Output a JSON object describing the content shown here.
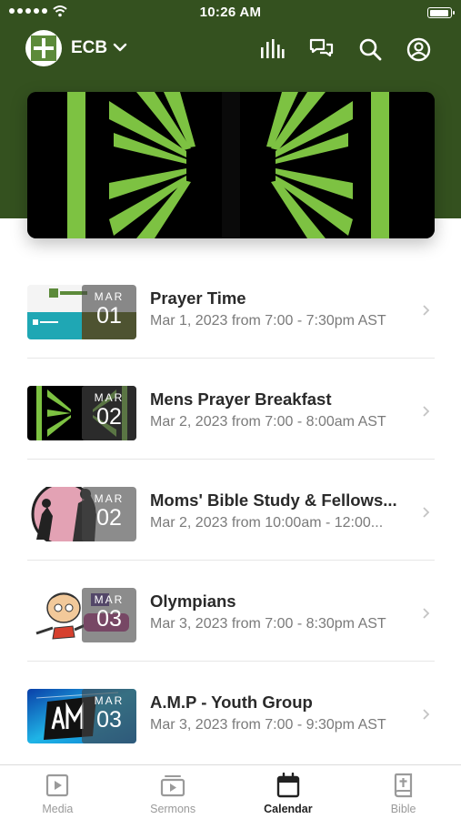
{
  "status_bar": {
    "time": "10:26 AM"
  },
  "header": {
    "church_name": "ECB"
  },
  "events": [
    {
      "title": "Prayer Time",
      "subtitle": "Mar 1, 2023 from 7:00 - 7:30pm AST",
      "month": "MAR",
      "day": "01",
      "thumb": "church-banner"
    },
    {
      "title": "Mens Prayer Breakfast",
      "subtitle": "Mar 2, 2023 from 7:00 - 8:00am AST",
      "month": "MAR",
      "day": "02",
      "thumb": "green-rays"
    },
    {
      "title": "Moms' Bible Study & Fellows...",
      "subtitle": "Mar 2, 2023 from 10:00am - 12:00...",
      "month": "MAR",
      "day": "02",
      "thumb": "mom-silhouette"
    },
    {
      "title": "Olympians",
      "subtitle": "Mar 3, 2023 from 7:00 - 8:30pm AST",
      "month": "MAR",
      "day": "03",
      "thumb": "cartoon-kid"
    },
    {
      "title": "A.M.P - Youth Group",
      "subtitle": "Mar 3, 2023 from 7:00 - 9:30pm AST",
      "month": "MAR",
      "day": "03",
      "thumb": "amp-logo"
    }
  ],
  "tabs": [
    {
      "label": "Media",
      "icon": "play-square-icon",
      "active": false
    },
    {
      "label": "Sermons",
      "icon": "video-library-icon",
      "active": false
    },
    {
      "label": "Calendar",
      "icon": "calendar-icon",
      "active": true
    },
    {
      "label": "Bible",
      "icon": "bible-icon",
      "active": false
    }
  ],
  "colors": {
    "header_green": "#34511f",
    "hero_green": "#7dc242",
    "tab_active": "#222222",
    "tab_inactive": "#9a9a9a"
  }
}
